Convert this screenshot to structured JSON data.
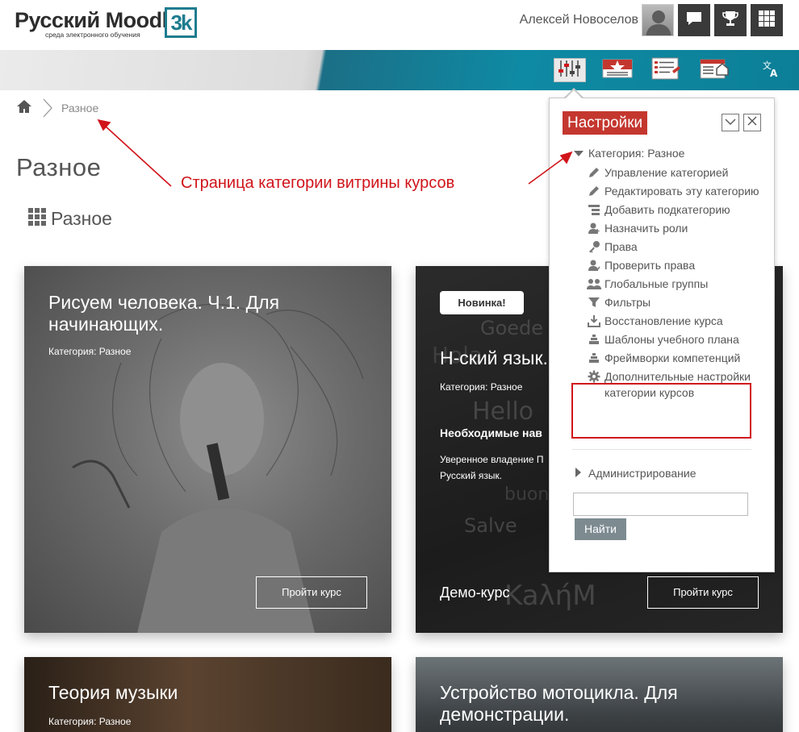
{
  "header": {
    "logo_text": "Русский Moodle",
    "logo_badge": "3k",
    "logo_sub": "среда электронного обучения",
    "user_name": "Алексей Новоселов",
    "buttons": [
      "messages-icon",
      "trophy-icon",
      "grid-icon"
    ]
  },
  "band": {
    "icons": [
      "settings-sliders-icon",
      "featured-star-icon",
      "checklist-icon",
      "dashboard-home-icon",
      "translate-icon"
    ]
  },
  "breadcrumb": {
    "home": "home-icon",
    "current": "Разное"
  },
  "page": {
    "title": "Разное",
    "category_heading": "Разное"
  },
  "annotation": {
    "text": "Страница категории витрины курсов",
    "color": "#d0141a"
  },
  "cards": [
    {
      "title": "Рисуем человека. Ч.1. Для начинающих.",
      "category": "Категория: Разное",
      "button": "Пройти курс"
    },
    {
      "badge": "Новинка!",
      "title": "Н-ский язык.",
      "category": "Категория: Разное",
      "req_heading": "Необходимые нав",
      "req_text_1": "Уверенное владение П",
      "req_text_2": "Русский язык.",
      "demo": "Демо-курс",
      "button": "Пройти курс"
    },
    {
      "title": "Теория музыки",
      "category": "Категория: Разное"
    },
    {
      "title": "Устройство мотоцикла. Для демонстрации."
    }
  ],
  "settings_panel": {
    "title": "Настройки",
    "title_color": "#c4372f",
    "root": "Категория: Разное",
    "items": [
      {
        "icon": "pencil-icon",
        "label": "Управление категорией"
      },
      {
        "icon": "pencil-icon",
        "label": "Редактировать эту категорию"
      },
      {
        "icon": "add-subcategory-icon",
        "label": "Добавить подкатегорию"
      },
      {
        "icon": "assign-roles-icon",
        "label": "Назначить роли"
      },
      {
        "icon": "key-icon",
        "label": "Права"
      },
      {
        "icon": "check-permissions-icon",
        "label": "Проверить права"
      },
      {
        "icon": "groups-icon",
        "label": "Глобальные группы"
      },
      {
        "icon": "filter-icon",
        "label": "Фильтры"
      },
      {
        "icon": "restore-icon",
        "label": "Восстановление курса"
      },
      {
        "icon": "template-icon",
        "label": "Шаблоны учебного плана"
      },
      {
        "icon": "competency-icon",
        "label": "Фреймворки компетенций"
      },
      {
        "icon": "gear-icon",
        "label": "Дополнительные настройки категории курсов"
      }
    ],
    "admin": "Администрирование",
    "search_value": "",
    "search_button": "Найти"
  }
}
